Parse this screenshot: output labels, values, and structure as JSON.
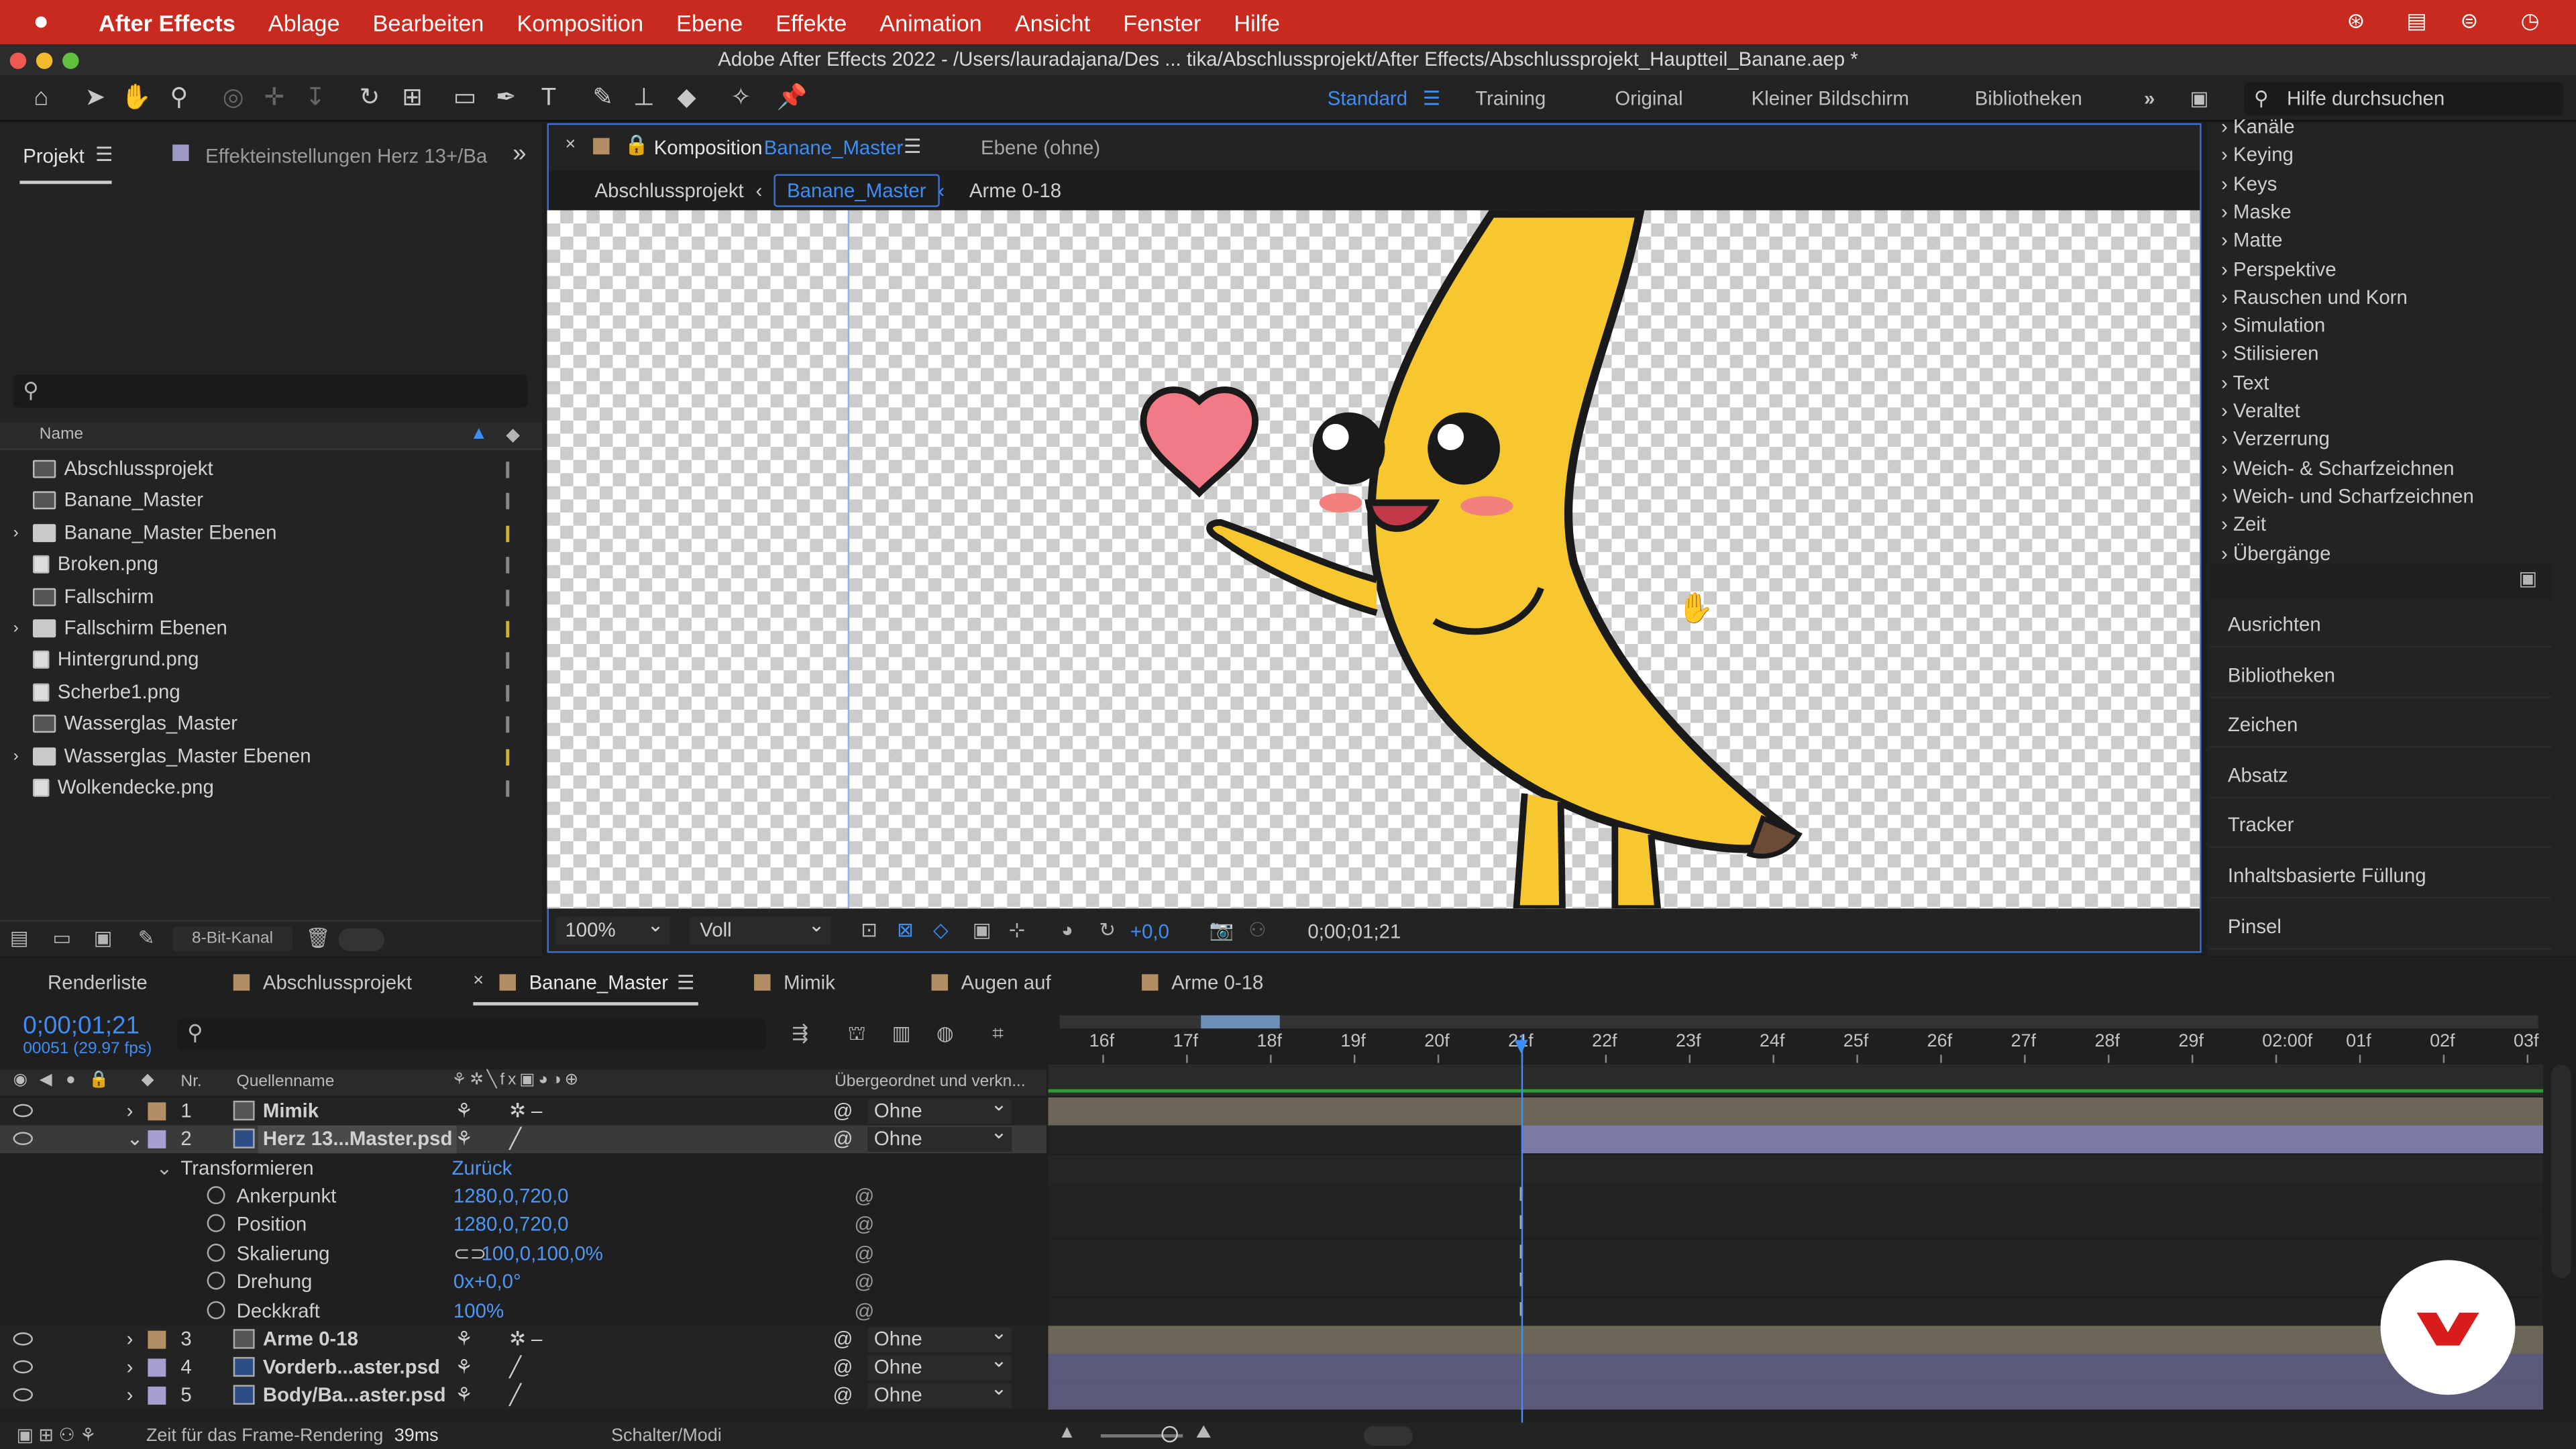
{
  "menubar": {
    "app": "After Effects",
    "items": [
      "Ablage",
      "Bearbeiten",
      "Komposition",
      "Ebene",
      "Effekte",
      "Animation",
      "Ansicht",
      "Fenster",
      "Hilfe"
    ]
  },
  "titlebar": {
    "title": "Adobe After Effects 2022 - /Users/lauradajana/Des ... tika/Abschlussprojekt/After Effects/Abschlussprojekt_Hauptteil_Banane.aep *"
  },
  "workspaces": {
    "items": [
      "Standard",
      "Training",
      "Original",
      "Kleiner Bildschirm",
      "Bibliotheken"
    ],
    "active": "Standard"
  },
  "help": {
    "placeholder": "Hilfe durchsuchen"
  },
  "project": {
    "tab": "Projekt",
    "tab2": "Effekteinstellungen Herz 13+/Ba",
    "header": "Name",
    "items": [
      {
        "name": "Abschlussprojekt",
        "type": "comp"
      },
      {
        "name": "Banane_Master",
        "type": "comp"
      },
      {
        "name": "Banane_Master Ebenen",
        "type": "folder"
      },
      {
        "name": "Broken.png",
        "type": "file"
      },
      {
        "name": "Fallschirm",
        "type": "comp"
      },
      {
        "name": "Fallschirm Ebenen",
        "type": "folder"
      },
      {
        "name": "Hintergrund.png",
        "type": "file"
      },
      {
        "name": "Scherbe1.png",
        "type": "file"
      },
      {
        "name": "Wasserglas_Master",
        "type": "comp"
      },
      {
        "name": "Wasserglas_Master Ebenen",
        "type": "folder"
      },
      {
        "name": "Wolkendecke.png",
        "type": "file"
      }
    ],
    "bitdepth": "8-Bit-Kanal"
  },
  "comp": {
    "tab_prefix": "Komposition",
    "tab_name": "Banane_Master",
    "layer_tab": "Ebene (ohne)",
    "breadcrumb": [
      "Abschlussprojekt",
      "Banane_Master",
      "Arme 0-18"
    ],
    "zoom": "100%",
    "quality": "Voll",
    "exposure": "+0,0",
    "timecode": "0;00;01;21"
  },
  "effects": {
    "items": [
      "Kanäle",
      "Keying",
      "Keys",
      "Maske",
      "Matte",
      "Perspektive",
      "Rauschen und Korn",
      "Simulation",
      "Stilisieren",
      "Text",
      "Veraltet",
      "Verzerrung",
      "Weich- & Scharfzeichnen",
      "Weich- und Scharfzeichnen",
      "Zeit",
      "Übergänge"
    ]
  },
  "right_panels": [
    "Ausrichten",
    "Bibliotheken",
    "Zeichen",
    "Absatz",
    "Tracker",
    "Inhaltsbasierte Füllung",
    "Pinsel"
  ],
  "timeline": {
    "tabs": [
      "Renderliste",
      "Abschlussprojekt",
      "Banane_Master",
      "Mimik",
      "Augen auf",
      "Arme 0-18"
    ],
    "tab_colors": [
      "#b38d63",
      "#b38d63",
      "#b38d63",
      "#b38d63",
      "#b38d63"
    ],
    "timecode": "0;00;01;21",
    "frames": "00051 (29.97 fps)",
    "col_nr": "Nr.",
    "col_source": "Quellenname",
    "col_parent": "Übergeordnet und verkn...",
    "ticks": [
      "16f",
      "17f",
      "18f",
      "19f",
      "20f",
      "21f",
      "22f",
      "23f",
      "24f",
      "25f",
      "26f",
      "27f",
      "28f",
      "29f",
      "02:00f",
      "01f",
      "02f",
      "03f"
    ],
    "layers": [
      {
        "nr": "1",
        "name": "Mimik",
        "parent": "Ohne",
        "color": "#b38d63"
      },
      {
        "nr": "2",
        "name": "Herz 13...Master.psd",
        "parent": "Ohne",
        "color": "#a5a0cf"
      },
      {
        "nr": "3",
        "name": "Arme 0-18",
        "parent": "Ohne",
        "color": "#b38d63"
      },
      {
        "nr": "4",
        "name": "Vorderb...aster.psd",
        "parent": "Ohne",
        "color": "#a5a0cf"
      },
      {
        "nr": "5",
        "name": "Body/Ba...aster.psd",
        "parent": "Ohne",
        "color": "#a5a0cf"
      }
    ],
    "transform": {
      "label": "Transformieren",
      "reset": "Zurück",
      "props": [
        {
          "name": "Ankerpunkt",
          "value": "1280,0,720,0"
        },
        {
          "name": "Position",
          "value": "1280,0,720,0"
        },
        {
          "name": "Skalierung",
          "value": "100,0,100,0%"
        },
        {
          "name": "Drehung",
          "value": "0x+0,0°"
        },
        {
          "name": "Deckkraft",
          "value": "100%"
        }
      ]
    },
    "status_label": "Zeit für das Frame-Rendering",
    "status_value": "39ms",
    "modes": "Schalter/Modi"
  }
}
